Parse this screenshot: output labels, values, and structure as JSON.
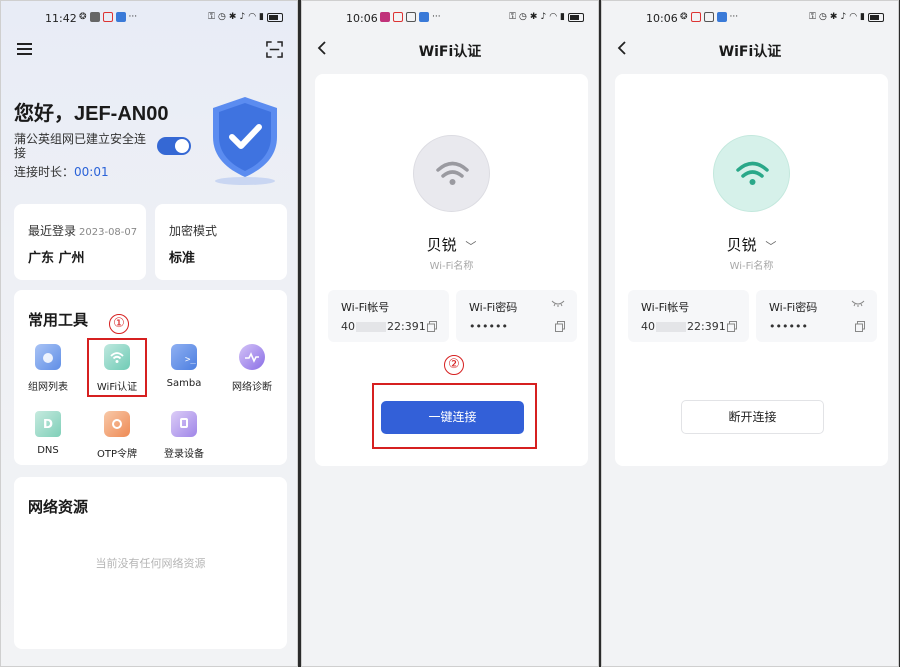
{
  "screen1": {
    "status": {
      "time": "11:42"
    },
    "greeting": "您好，JEF-AN00",
    "connection_text": "蒲公英组网已建立安全连接",
    "duration_label": "连接时长：",
    "duration_value": "00:01",
    "toggle_on": true,
    "last_login": {
      "label": "最近登录",
      "date": "2023-08-07",
      "value": "广东 广州"
    },
    "encryption": {
      "label": "加密模式",
      "value": "标准"
    },
    "tools": {
      "title": "常用工具",
      "items": [
        {
          "label": "组网列表",
          "icon": "network-list-icon"
        },
        {
          "label": "WiFi认证",
          "icon": "wifi-auth-icon"
        },
        {
          "label": "Samba",
          "icon": "folder-terminal-icon"
        },
        {
          "label": "网络诊断",
          "icon": "diagnostic-icon"
        },
        {
          "label": "DNS",
          "icon": "dns-icon"
        },
        {
          "label": "OTP令牌",
          "icon": "otp-token-icon"
        },
        {
          "label": "登录设备",
          "icon": "login-device-icon"
        }
      ]
    },
    "resources": {
      "title": "网络资源",
      "empty_text": "当前没有任何网络资源"
    },
    "step_marker": "①"
  },
  "screen2": {
    "status": {
      "time": "10:06"
    },
    "title": "WiFi认证",
    "ssid": "贝锐",
    "ssid_sub": "Wi-Fi名称",
    "account_label": "Wi-Fi帐号",
    "account_prefix": "40",
    "account_suffix": "22:391",
    "password_label": "Wi-Fi密码",
    "password_value": "••••••",
    "button_label": "一键连接",
    "step_marker": "②",
    "wifi_color": "#9a9aa0"
  },
  "screen3": {
    "status": {
      "time": "10:06"
    },
    "title": "WiFi认证",
    "ssid": "贝锐",
    "ssid_sub": "Wi-Fi名称",
    "account_label": "Wi-Fi帐号",
    "account_prefix": "40",
    "account_suffix": "22:391",
    "password_label": "Wi-Fi密码",
    "password_value": "••••••",
    "button_label": "断开连接",
    "wifi_color": "#2aa889"
  },
  "colors": {
    "accent": "#3360d8",
    "highlight": "#d62020",
    "connected": "#2aa889"
  }
}
